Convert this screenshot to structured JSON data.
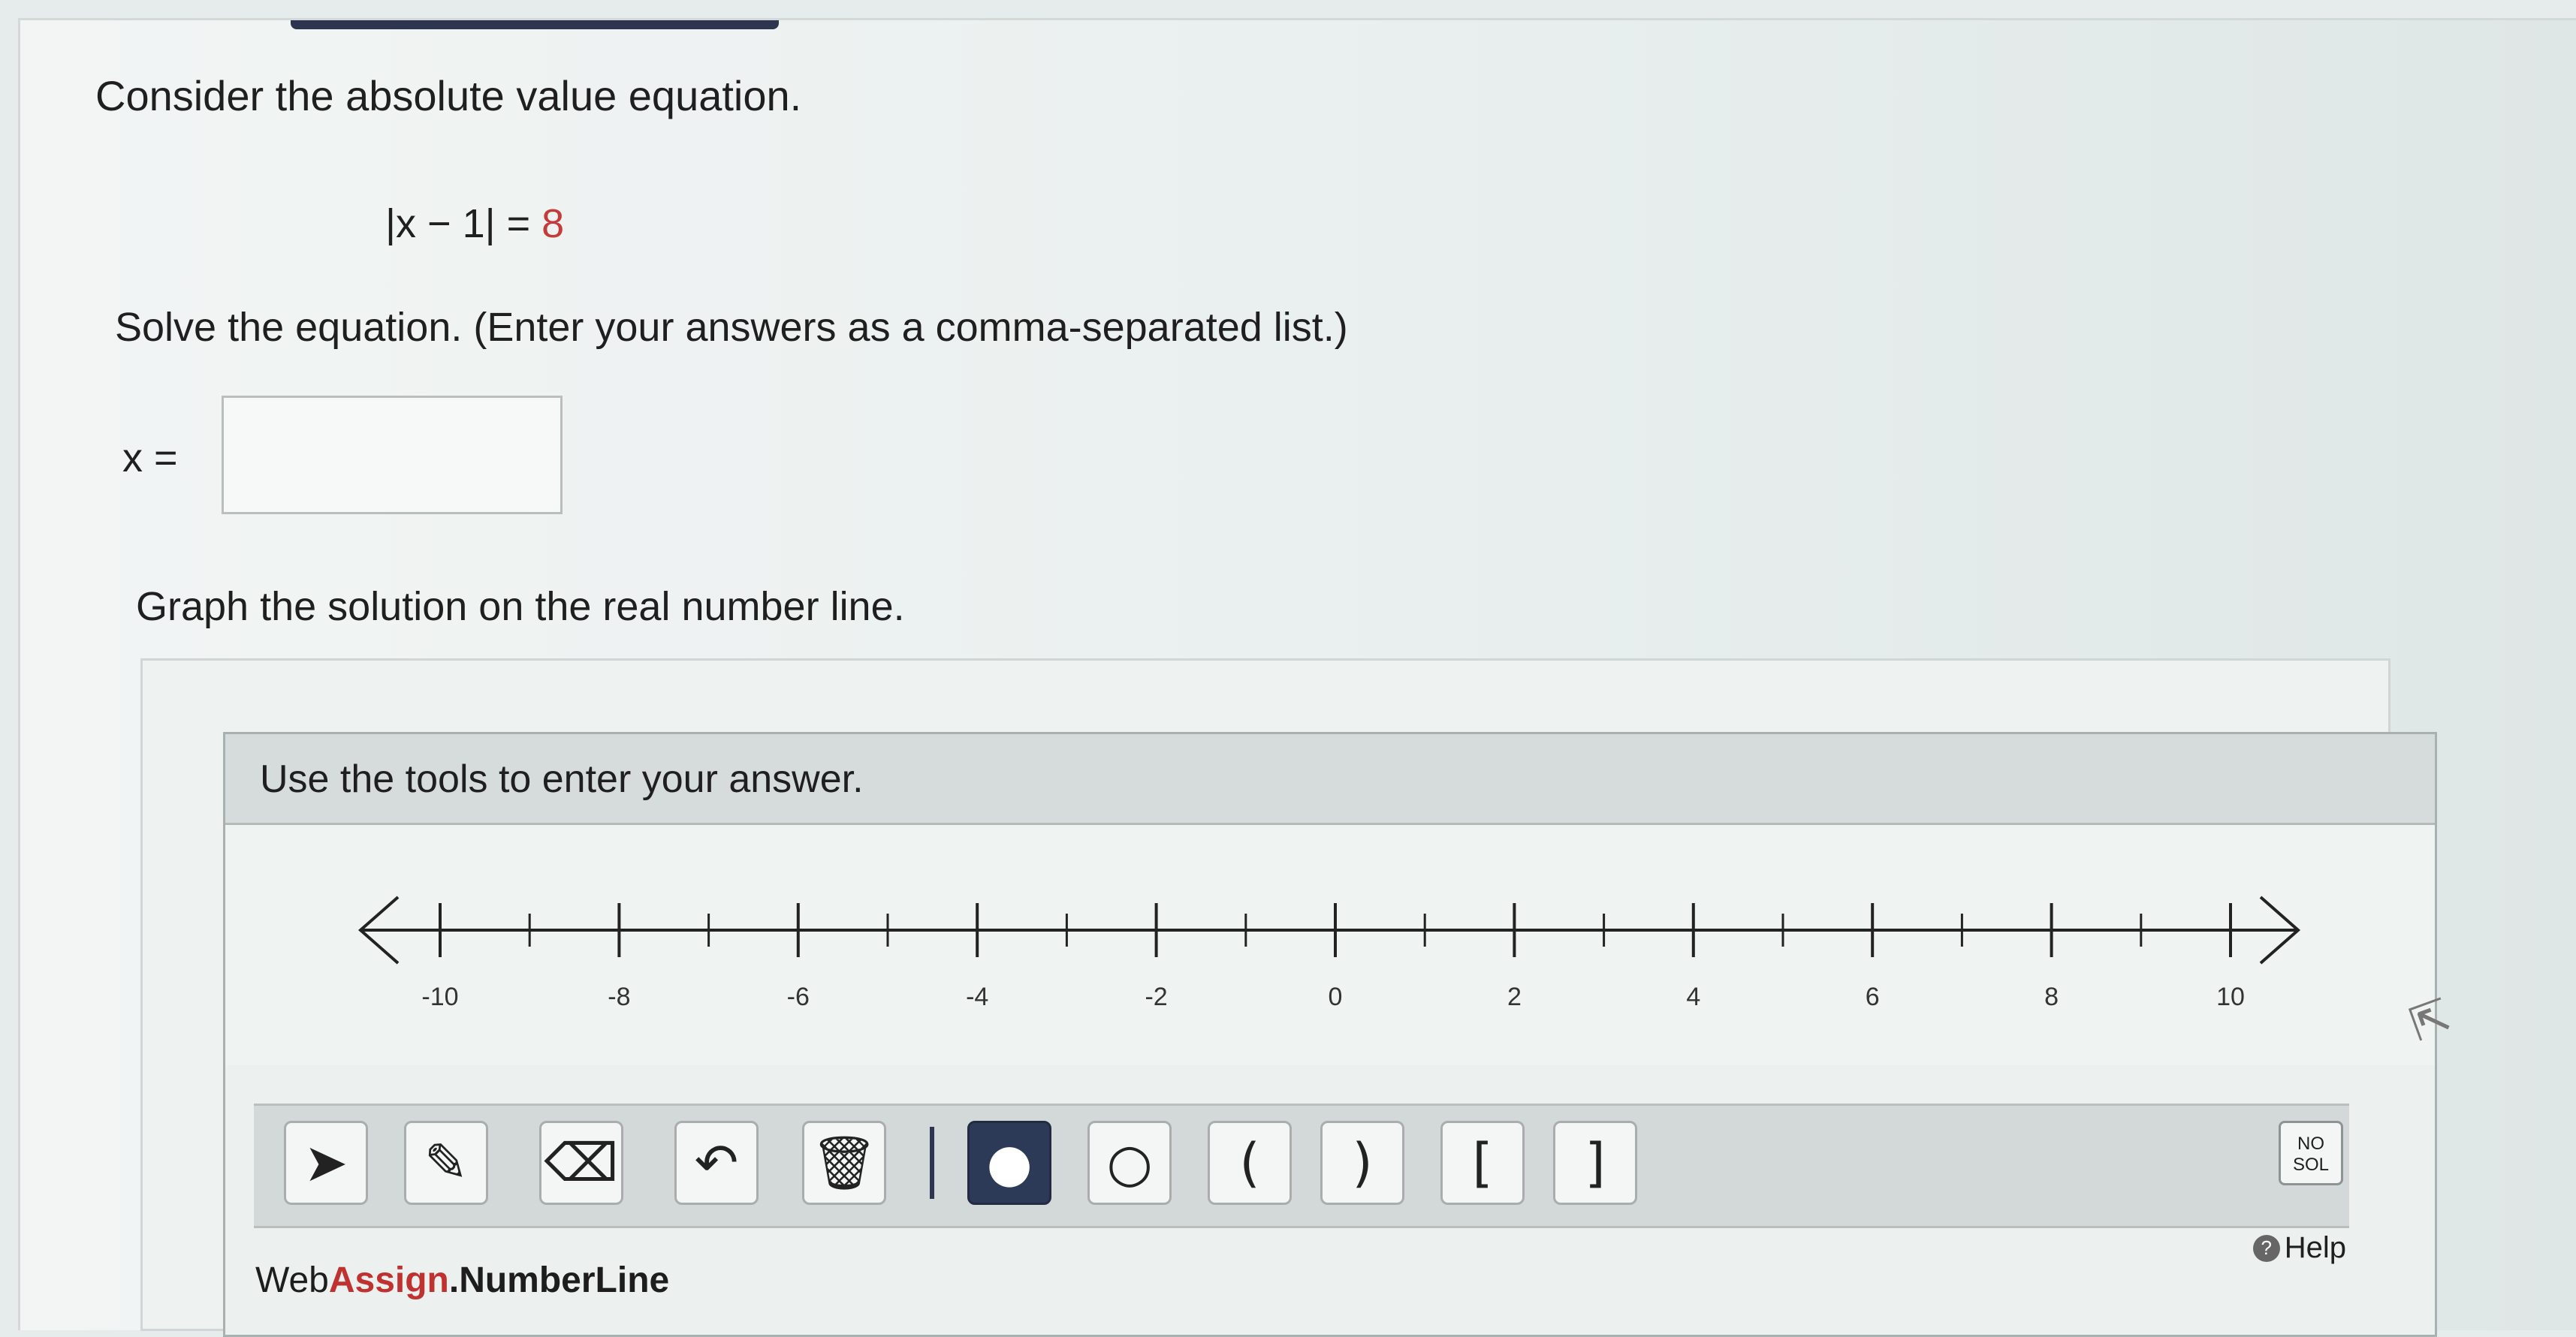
{
  "question": {
    "intro": "Consider the absolute value equation.",
    "equation_lhs": "|x − 1| = ",
    "equation_rhs": "8",
    "solve_instruction": "Solve the equation. (Enter your answers as a comma-separated list.)",
    "answer_label": "x =",
    "answer_value": "",
    "graph_instruction": "Graph the solution on the real number line."
  },
  "numberline": {
    "header": "Use the tools to enter your answer.",
    "tick_labels": [
      "-10",
      "-8",
      "-6",
      "-4",
      "-2",
      "0",
      "2",
      "4",
      "6",
      "8",
      "10"
    ],
    "tools": [
      {
        "name": "pointer-tool",
        "icon": "pointer-icon",
        "glyph": "➤"
      },
      {
        "name": "pencil-tool",
        "icon": "pencil-icon",
        "glyph": "✎"
      },
      {
        "name": "eraser-tool",
        "icon": "eraser-icon",
        "glyph": "⌫"
      },
      {
        "name": "undo-tool",
        "icon": "undo-icon",
        "glyph": "↶"
      },
      {
        "name": "trash-tool",
        "icon": "trash-icon",
        "glyph": "🗑"
      },
      {
        "name": "closed-point-tool",
        "icon": "filled-circle-icon",
        "glyph": "●"
      },
      {
        "name": "open-point-tool",
        "icon": "open-circle-icon",
        "glyph": "○"
      },
      {
        "name": "left-paren-tool",
        "icon": "left-paren-icon",
        "glyph": "("
      },
      {
        "name": "right-paren-tool",
        "icon": "right-paren-icon",
        "glyph": ")"
      },
      {
        "name": "left-bracket-tool",
        "icon": "left-bracket-icon",
        "glyph": "["
      },
      {
        "name": "right-bracket-tool",
        "icon": "right-bracket-icon",
        "glyph": "]"
      }
    ],
    "active_tool": "closed-point-tool",
    "no_solution_line1": "NO",
    "no_solution_line2": "SOL",
    "help_label": "Help",
    "brand_web": "Web",
    "brand_assign": "Assign",
    "brand_product": ".NumberLine"
  },
  "colors": {
    "accent": "#2d3a57",
    "equation_red": "#c53b3b",
    "brand_red": "#c0322f"
  }
}
